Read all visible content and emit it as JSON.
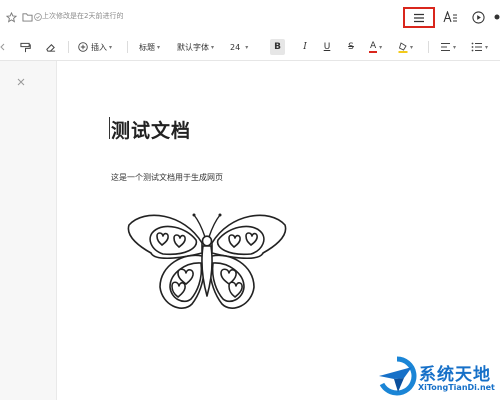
{
  "header": {
    "save_status": "上次修改是在2天前进行的"
  },
  "toolbar": {
    "insert_label": "插入",
    "heading_label": "标题",
    "font_label": "默认字体",
    "font_size": "24",
    "bold_glyph": "B",
    "italic_glyph": "I",
    "underline_glyph": "U",
    "strike_glyph": "S",
    "font_color_glyph": "A",
    "accent_color": "#d9261c"
  },
  "icons": {
    "outline_button": "menu-icon",
    "text_style": "text-style-icon",
    "present": "play-circle-icon"
  },
  "document": {
    "title": "测试文档",
    "body": "这是一个测试文档用于生成网页"
  },
  "watermark": {
    "name": "系统天地",
    "url": "XiTongTianDi.net"
  }
}
